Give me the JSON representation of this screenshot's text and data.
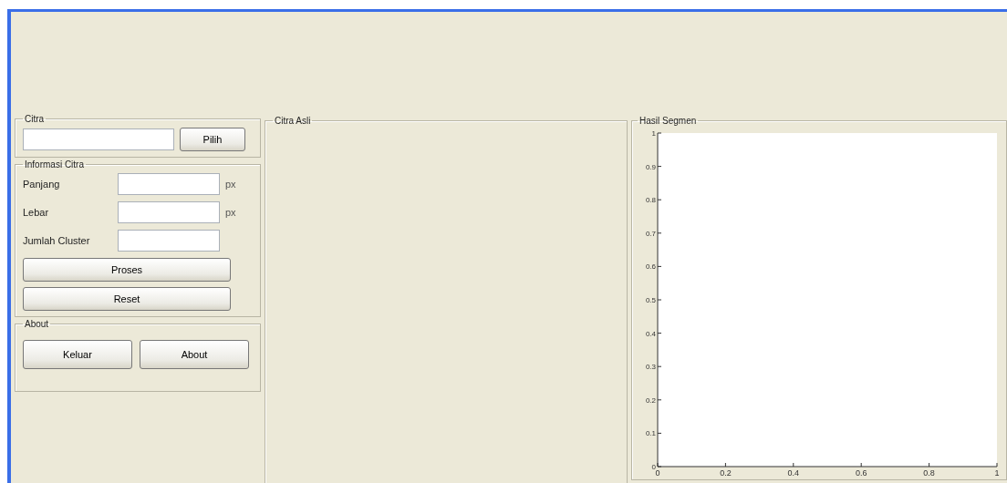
{
  "citra": {
    "title": "Citra",
    "button": "Pilih"
  },
  "informasi": {
    "title": "Informasi Citra",
    "fields": [
      {
        "label": "Panjang",
        "unit": "px"
      },
      {
        "label": "Lebar",
        "unit": "px"
      },
      {
        "label": "Jumlah Cluster"
      }
    ],
    "buttons": [
      "Proses",
      "Reset"
    ]
  },
  "about": {
    "title": "About",
    "buttons": [
      "Keluar",
      "About"
    ]
  },
  "citra_asli": {
    "title": "Citra Asli"
  },
  "hasil_segmen": {
    "title": "Hasil Segmen",
    "chart_data": {
      "type": "line",
      "xlim": [
        0,
        1
      ],
      "ylim": [
        0,
        1
      ],
      "xticks": [
        {
          "value": 0,
          "label": "0"
        },
        {
          "value": 0.2,
          "label": "0.2"
        },
        {
          "value": 0.4,
          "label": "0.4"
        },
        {
          "value": 0.6,
          "label": "0.6"
        },
        {
          "value": 0.8,
          "label": "0.8"
        },
        {
          "value": 1,
          "label": "1"
        }
      ],
      "yticks": [
        0,
        0.1,
        0.2,
        0.3,
        0.4,
        0.5,
        0.6,
        0.7,
        0.8,
        0.9,
        1
      ]
    }
  }
}
